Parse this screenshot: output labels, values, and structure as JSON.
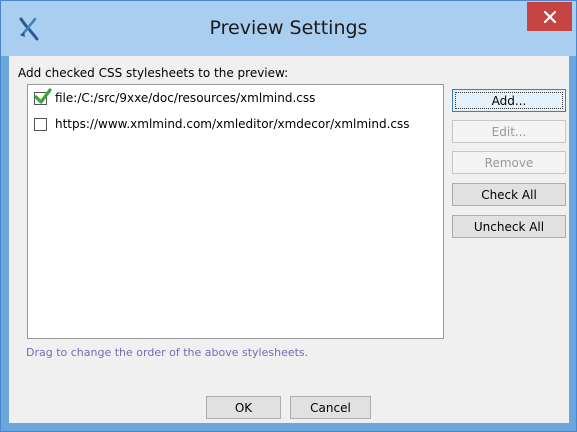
{
  "window": {
    "title": "Preview Settings",
    "icon": "xmlmind-logo-icon",
    "close_icon": "close-icon"
  },
  "dialog": {
    "instruction": "Add checked CSS stylesheets to the preview:",
    "stylesheets": [
      {
        "label": "file:/C:/src/9xxe/doc/resources/xmlmind.css",
        "checked": true
      },
      {
        "label": "https://www.xmlmind.com/xmleditor/xmdecor/xmlmind.css",
        "checked": false
      }
    ],
    "hint": "Drag to change the order of the above stylesheets."
  },
  "buttons": {
    "add": "Add...",
    "edit": "Edit...",
    "remove": "Remove",
    "check_all": "Check All",
    "uncheck_all": "Uncheck All",
    "ok": "OK",
    "cancel": "Cancel"
  },
  "colors": {
    "checkmark": "#3aa53a",
    "close_button": "#c74444",
    "titlebar": "#a9cef0",
    "hint_text": "#6f6fb8"
  }
}
